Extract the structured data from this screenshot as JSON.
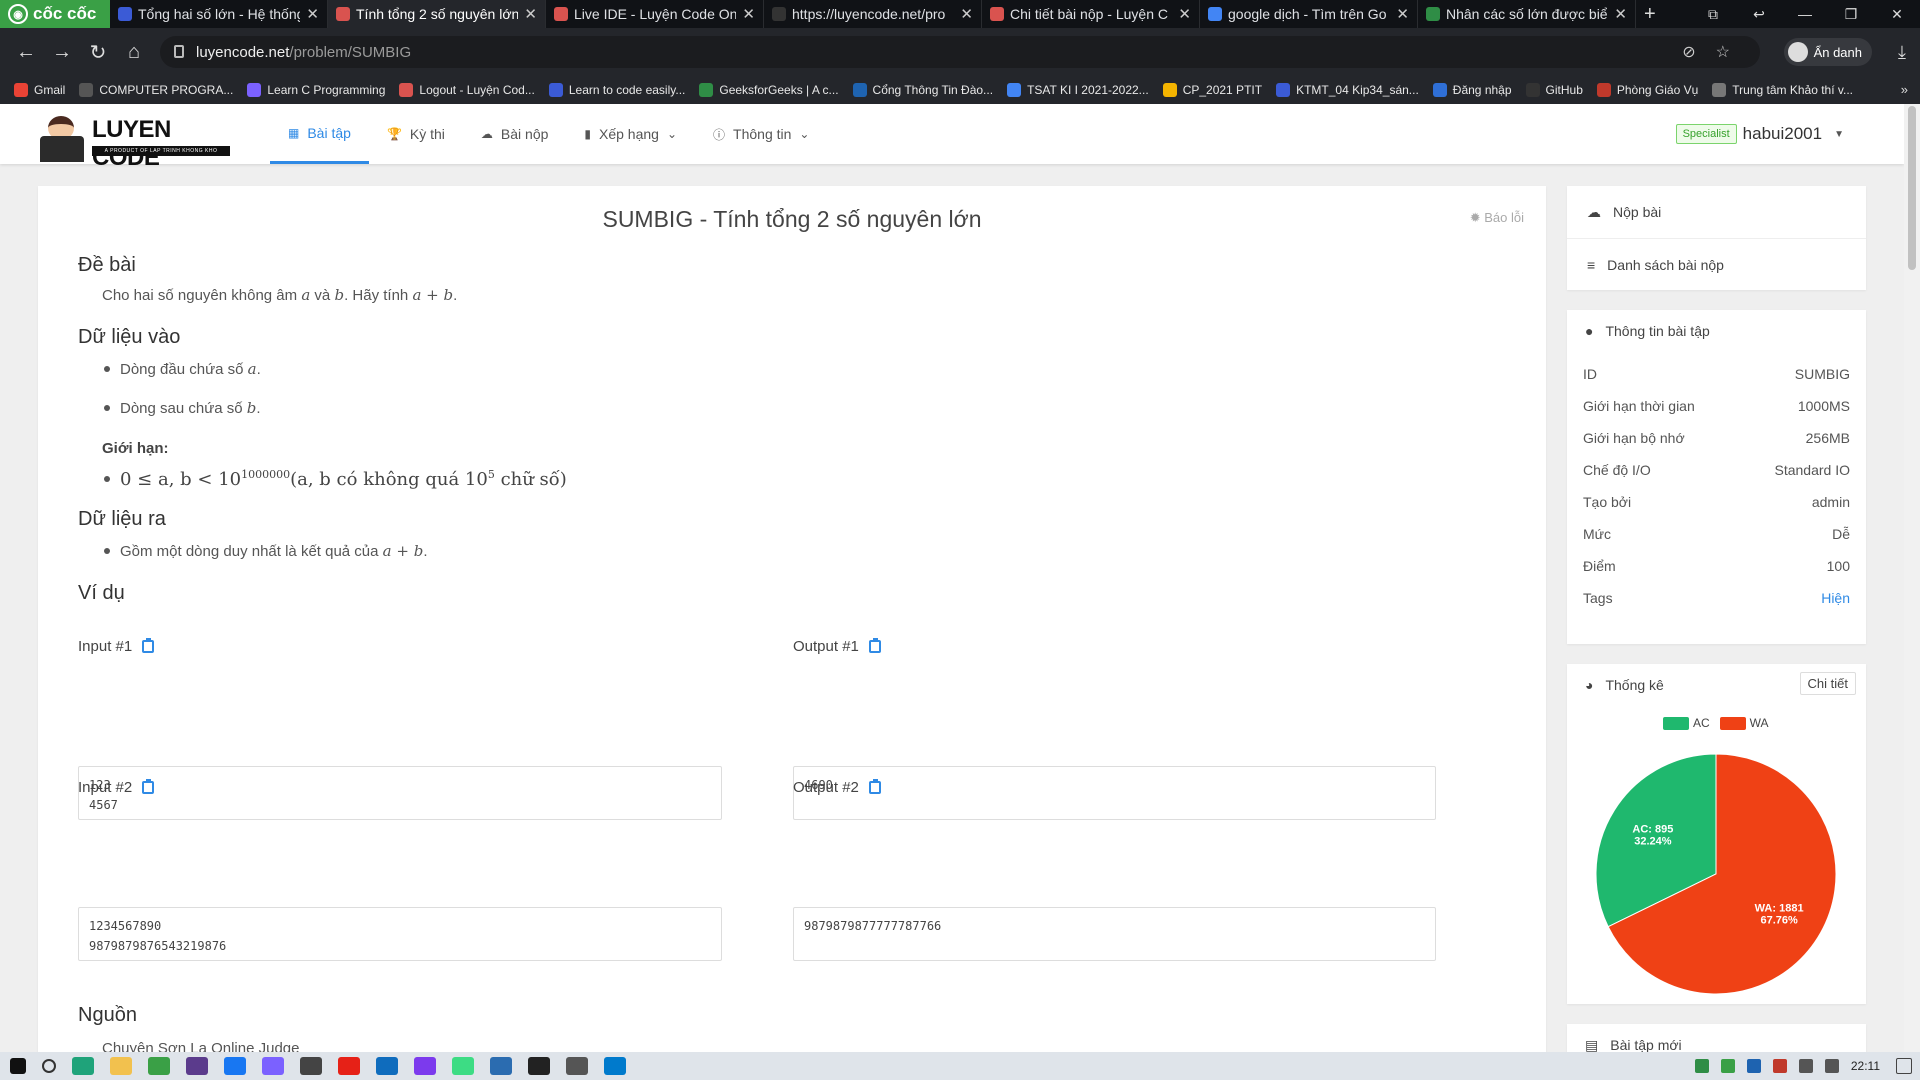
{
  "browser": {
    "brand": "cốc cốc",
    "tabs": [
      {
        "title": "Tổng hai số lớn - Hệ thống",
        "active": false,
        "color": "#3b5bd6"
      },
      {
        "title": "Tính tổng 2 số nguyên lớn",
        "active": true,
        "color": "#d9534f"
      },
      {
        "title": "Live IDE - Luyện Code Onl",
        "active": false,
        "color": "#d9534f"
      },
      {
        "title": "https://luyencode.net/pro",
        "active": false,
        "color": "#333333"
      },
      {
        "title": "Chi tiết bài nộp - Luyện C",
        "active": false,
        "color": "#d9534f"
      },
      {
        "title": "google dịch - Tìm trên Go",
        "active": false,
        "color": "#4285f4"
      },
      {
        "title": "Nhân các số lớn được biể",
        "active": false,
        "color": "#2f8d46"
      }
    ],
    "url_host": "luyencode.net",
    "url_path": "/problem/SUMBIG",
    "incognito_label": "Ẩn danh",
    "bookmarks": [
      {
        "label": "Gmail",
        "color": "#ea4335"
      },
      {
        "label": "COMPUTER PROGRA...",
        "color": "#555555"
      },
      {
        "label": "Learn C Programming",
        "color": "#7b61ff"
      },
      {
        "label": "Logout - Luyện Cod...",
        "color": "#d9534f"
      },
      {
        "label": "Learn to code easily...",
        "color": "#3b5bd6"
      },
      {
        "label": "GeeksforGeeks | A c...",
        "color": "#2f8d46"
      },
      {
        "label": "Cổng Thông Tin Đào...",
        "color": "#1e63b0"
      },
      {
        "label": "TSAT KI I 2021-2022...",
        "color": "#4285f4"
      },
      {
        "label": "CP_2021 PTIT",
        "color": "#f4b400"
      },
      {
        "label": "KTMT_04 Kip34_sán...",
        "color": "#3b5bd6"
      },
      {
        "label": "Đăng nhập",
        "color": "#2f6fd6"
      },
      {
        "label": "GitHub",
        "color": "#333333"
      },
      {
        "label": "Phòng Giáo Vụ",
        "color": "#c0392b"
      },
      {
        "label": "Trung tâm Khảo thí v...",
        "color": "#777777"
      }
    ]
  },
  "site": {
    "logo_text": "LUYEN CODE",
    "logo_tagline": "A PRODUCT OF LAP TRINH KHONG KHO",
    "menu": [
      {
        "label": "Bài tập",
        "icon": "grid-icon",
        "glyph": "▦",
        "active": true
      },
      {
        "label": "Kỳ thi",
        "icon": "trophy-icon",
        "glyph": "🏆",
        "active": false
      },
      {
        "label": "Bài nộp",
        "icon": "cloud-icon",
        "glyph": "☁",
        "active": false
      },
      {
        "label": "Xếp hạng",
        "icon": "bar-chart-icon",
        "glyph": "▮",
        "active": false,
        "dropdown": true
      },
      {
        "label": "Thông tin",
        "icon": "info-icon",
        "glyph": "ⓘ",
        "active": false,
        "dropdown": true
      }
    ],
    "user_badge": "Specialist",
    "username": "habui2001"
  },
  "problem": {
    "title": "SUMBIG - Tính tổng 2 số nguyên lớn",
    "report_label": "Báo lỗi",
    "sections": {
      "statement_h": "Đề bài",
      "input_h": "Dữ liệu vào",
      "output_h": "Dữ liệu ra",
      "examples_h": "Ví dụ",
      "source_h": "Nguồn"
    },
    "statement_pre": "Cho hai số nguyên không âm ",
    "statement_a": "a",
    "statement_mid": " và ",
    "statement_b": "b",
    "statement_post": ". Hãy tính ",
    "statement_expr": "a + b",
    "statement_end": ".",
    "input_line1_pre": "Dòng đầu chứa số ",
    "input_line1_var": "a",
    "input_line2_pre": "Dòng sau chứa số ",
    "input_line2_var": "b",
    "limits_label": "Giới hạn:",
    "limit_math_main": "0 ≤ a, b < 10",
    "limit_math_exp": "1000000",
    "limit_math_rest": "(a, b có không quá 10",
    "limit_math_exp2": "5",
    "limit_math_tail": " chữ số)",
    "output_line_pre": "Gồm một dòng duy nhất là kết quả của ",
    "output_line_expr": "a + b",
    "source_text": "Chuyên Sơn La Online Judge",
    "examples": [
      {
        "in_label": "Input #1",
        "in": "123\n4567",
        "out_label": "Output #1",
        "out": "4690"
      },
      {
        "in_label": "Input #2",
        "in": "1234567890\n9879879876543219876",
        "out_label": "Output #2",
        "out": "9879879877777787766"
      }
    ]
  },
  "sidebar": {
    "submit_label": "Nộp bài",
    "submissions_label": "Danh sách bài nộp",
    "info_title": "Thông tin bài tập",
    "info": [
      {
        "k": "ID",
        "v": "SUMBIG"
      },
      {
        "k": "Giới hạn thời gian",
        "v": "1000MS"
      },
      {
        "k": "Giới hạn bộ nhớ",
        "v": "256MB"
      },
      {
        "k": "Chế độ I/O",
        "v": "Standard IO"
      },
      {
        "k": "Tạo bởi",
        "v": "admin"
      },
      {
        "k": "Mức",
        "v": "Dễ"
      },
      {
        "k": "Điểm",
        "v": "100"
      },
      {
        "k": "Tags",
        "v": "Hiện"
      }
    ],
    "stats_title": "Thống kê",
    "stats_detail": "Chi tiết",
    "next_title": "Bài tập mới"
  },
  "chart_data": {
    "type": "pie",
    "labels": [
      "AC",
      "WA"
    ],
    "values": [
      895,
      1881
    ],
    "percent_labels": [
      "32.24%",
      "67.76%"
    ],
    "colors": [
      "#1fb86e",
      "#ef4115"
    ],
    "legend_position": "top"
  },
  "taskbar": {
    "time": "22:11"
  }
}
